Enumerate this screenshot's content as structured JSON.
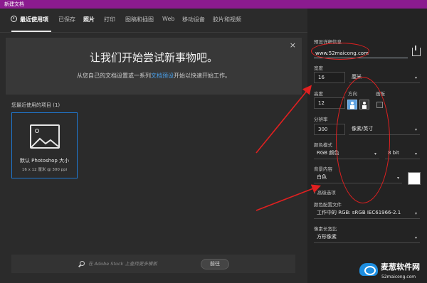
{
  "window": {
    "title": "新建文档"
  },
  "tabs": [
    {
      "label": "最近使用项",
      "active": true
    },
    {
      "label": "已保存",
      "active": false
    },
    {
      "label": "照片",
      "active": false
    },
    {
      "label": "打印",
      "active": false
    },
    {
      "label": "图稿和插图",
      "active": false
    },
    {
      "label": "Web",
      "active": false
    },
    {
      "label": "移动设备",
      "active": false
    },
    {
      "label": "胶片和视频",
      "active": false
    }
  ],
  "banner": {
    "title": "让我们开始尝试新事物吧。",
    "subtitle_before": "从您自己的文档设置或一系列",
    "subtitle_link": "文档预设",
    "subtitle_after": "开始以快速开始工作。",
    "close_icon": "×"
  },
  "recent": {
    "heading": "您最近使用的项目 (1)",
    "items": [
      {
        "name": "默认 Photoshop 大小",
        "meta": "16 x 12 厘米 @ 300 ppi"
      }
    ]
  },
  "stock_search": {
    "placeholder": "在 Adobe Stock 上查找更多模板",
    "go_label": "前往"
  },
  "preset_details": {
    "header": "预设详细信息",
    "name_value": "www.52maicong.com",
    "width_label": "宽度",
    "width_value": "16",
    "width_unit": "厘米",
    "height_label": "高度",
    "height_value": "12",
    "orientation_label": "方向",
    "artboard_label": "画板",
    "resolution_label": "分辨率",
    "resolution_value": "300",
    "resolution_unit": "像素/英寸",
    "color_mode_label": "颜色模式",
    "color_mode_value": "RGB 颜色",
    "bit_depth_value": "8 bit",
    "background_label": "背景内容",
    "background_value": "白色",
    "background_swatch": "#ffffff",
    "advanced_label": "高级选项",
    "advanced_chevron": "›",
    "color_profile_label": "颜色配置文件",
    "color_profile_value": "工作中的 RGB: sRGB IEC61966-2.1",
    "pixel_aspect_label": "像素长宽比",
    "pixel_aspect_value": "方形像素",
    "chevron": "▾"
  },
  "watermark": {
    "text": "麦葱软件网",
    "url": "52maicong.com"
  },
  "colors": {
    "title_bar": "#8b1b8f",
    "accent": "#1f78d1",
    "annotation": "#e02020"
  }
}
